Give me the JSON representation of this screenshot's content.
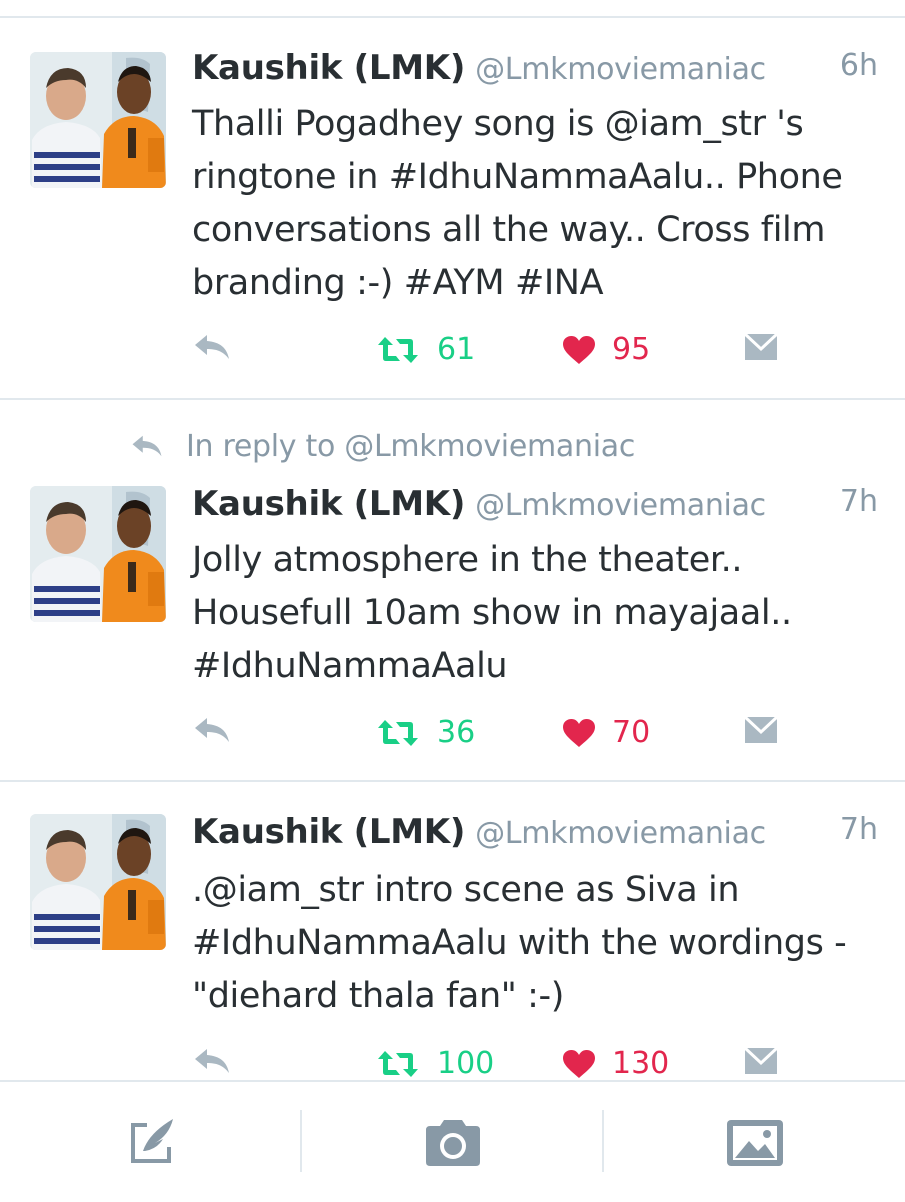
{
  "tweets": [
    {
      "display_name": "Kaushik (LMK)",
      "handle": "@Lmkmoviemaniac",
      "time": "6h",
      "text": "Thalli Pogadhey song is @iam_str 's ringtone in #IdhuNammaAalu.. Phone conversations all the way.. Cross film branding :-) #AYM #INA",
      "retweets": "61",
      "likes": "95"
    },
    {
      "reply_context": "In reply to @Lmkmoviemaniac",
      "display_name": "Kaushik (LMK)",
      "handle": "@Lmkmoviemaniac",
      "time": "7h",
      "text": "Jolly atmosphere in the theater.. Housefull 10am show in mayajaal.. #IdhuNammaAalu",
      "retweets": "36",
      "likes": "70"
    },
    {
      "display_name": "Kaushik (LMK)",
      "handle": "@Lmkmoviemaniac",
      "time": "7h",
      "text": ".@iam_str intro scene as Siva in #IdhuNammaAalu with the wordings - \"diehard thala fan\" :-)",
      "retweets": "100",
      "likes": "130"
    }
  ],
  "icons": {
    "reply": "reply-icon",
    "retweet": "retweet-icon",
    "like": "heart-icon",
    "dm": "direct-message-icon",
    "compose": "compose-tweet-icon",
    "camera": "camera-icon",
    "gallery": "gallery-icon"
  },
  "colors": {
    "retweet": "#19cf86",
    "like": "#e2264d",
    "muted": "#8899a6",
    "icon_gray": "#aab8c2",
    "divider": "#e1e8ed"
  }
}
